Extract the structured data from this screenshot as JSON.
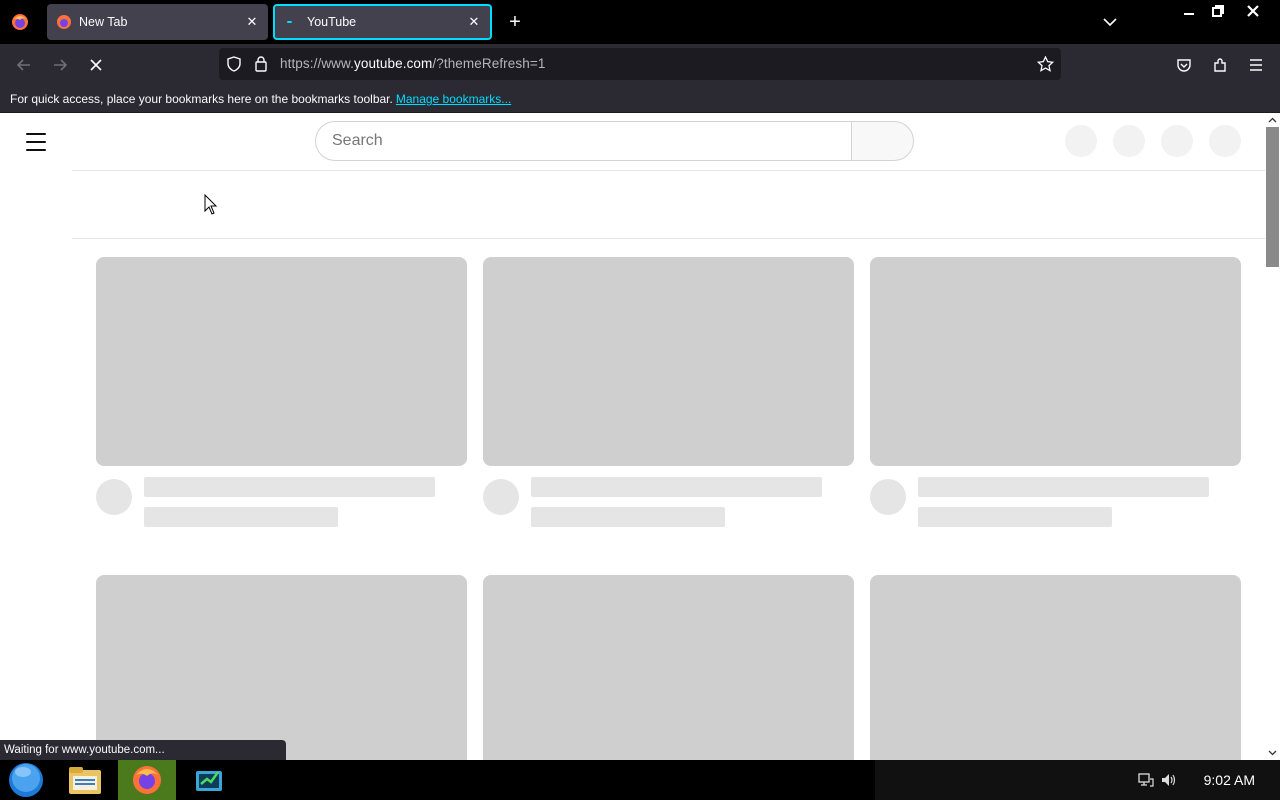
{
  "browser": {
    "tabs": [
      {
        "title": "New Tab",
        "active": false
      },
      {
        "title": "YouTube",
        "active": true
      }
    ],
    "url": {
      "prefix": "https://www.",
      "host": "youtube.com",
      "path": "/?themeRefresh=1"
    },
    "bookmarks_bar": {
      "message": "For quick access, place your bookmarks here on the bookmarks toolbar.",
      "link": "Manage bookmarks..."
    },
    "status_text": "Waiting for www.youtube.com..."
  },
  "page": {
    "search": {
      "placeholder": "Search"
    }
  },
  "taskbar": {
    "clock": "9:02 AM"
  },
  "colors": {
    "accent": "#00ddff",
    "skeleton": "#cfcfcf"
  }
}
